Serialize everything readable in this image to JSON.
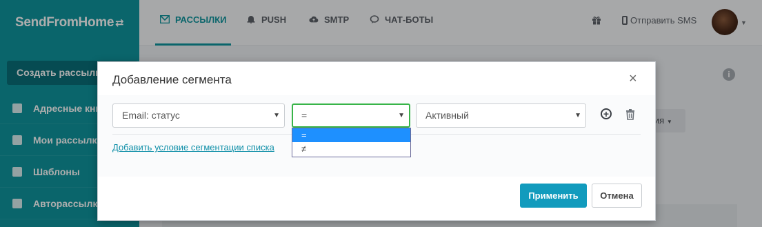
{
  "app": {
    "logo": "SendFromHome",
    "logo_icon": "swap-arrows-icon"
  },
  "sidebar": {
    "create_button": "Создать рассылку",
    "items": [
      {
        "label": "Адресные книги",
        "icon": "address-book-icon"
      },
      {
        "label": "Мои рассылки",
        "icon": "mailing-icon"
      },
      {
        "label": "Шаблоны",
        "icon": "templates-icon"
      },
      {
        "label": "Авторассылки",
        "icon": "autosend-icon"
      }
    ]
  },
  "topnav": {
    "items": [
      {
        "label": "РАССЫЛКИ",
        "icon": "envelope-icon",
        "active": true
      },
      {
        "label": "PUSH",
        "icon": "bell-icon",
        "active": false
      },
      {
        "label": "SMTP",
        "icon": "cloud-upload-icon",
        "active": false
      },
      {
        "label": "ЧАТ-БОТЫ",
        "icon": "chat-icon",
        "active": false
      }
    ],
    "send_sms": "Отправить SMS"
  },
  "background": {
    "partial_dropdown": "вия"
  },
  "modal": {
    "title": "Добавление сегмента",
    "field_select": "Email: статус",
    "operator_select": "=",
    "value_select": "Активный",
    "operator_options": [
      "=",
      "≠"
    ],
    "operator_selected_index": 0,
    "add_condition_link": "Добавить условие сегментации списка",
    "apply_button": "Применить",
    "cancel_button": "Отмена"
  },
  "colors": {
    "sidebar": "#0f969e",
    "accent": "#0f969e",
    "apply": "#129bbd",
    "focus_border": "#38b449",
    "option_selected": "#1e90ff"
  }
}
